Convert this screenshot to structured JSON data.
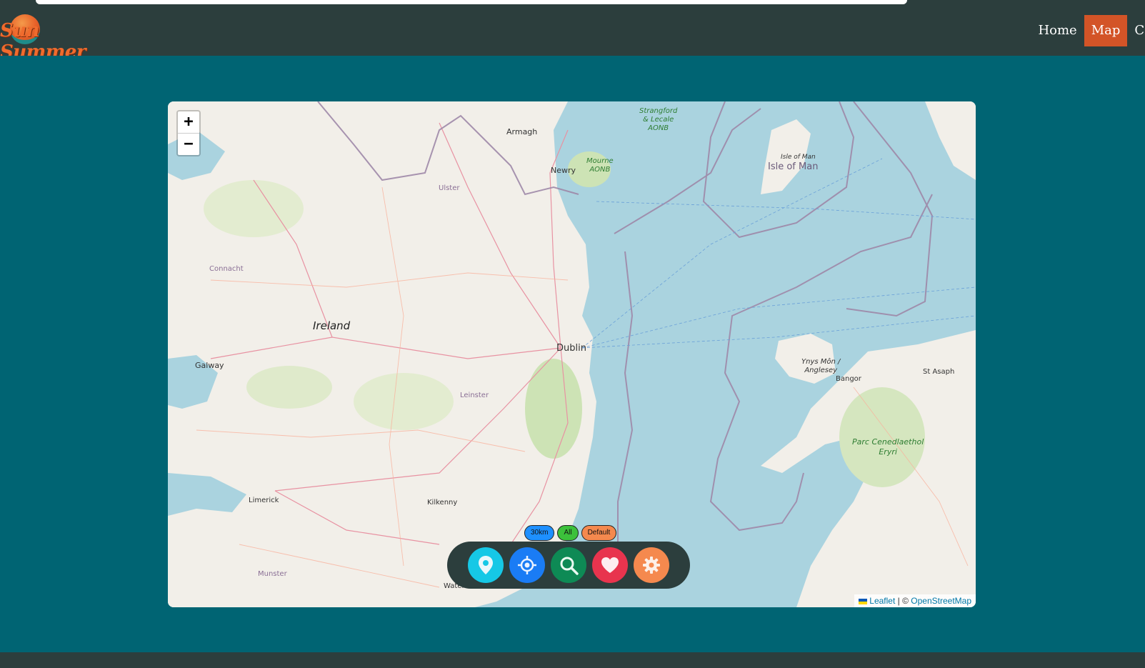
{
  "brand": {
    "logo_text": "Sun Summer"
  },
  "nav": {
    "items": [
      {
        "label": "Home",
        "active": false
      },
      {
        "label": "Map",
        "active": true
      },
      {
        "label": "Co",
        "active": false
      }
    ]
  },
  "map": {
    "zoom_in": "+",
    "zoom_out": "−",
    "labels": {
      "armagh": "Armagh",
      "newry": "Newry",
      "ulster": "Ulster",
      "strangford": "Strangford\n& Lecale\nAONB",
      "mourne": "Mourne\nAONB",
      "isle_of_man_small": "Isle of Man",
      "isle_of_man": "Isle of Man",
      "connacht": "Connacht",
      "ireland": "Ireland",
      "dublin": "Dublin",
      "galway": "Galway",
      "leinster": "Leinster",
      "ynys_mon": "Ynys Môn /\nAnglesey",
      "bangor": "Bangor",
      "st_asaph": "St Asaph",
      "eryri": "Parc Cenedlaethol\nEryri",
      "limerick": "Limerick",
      "kilkenny": "Kilkenny",
      "munster": "Munster",
      "waterford": "Water"
    },
    "attribution": {
      "leaflet": "Leaflet",
      "separator": "| ©",
      "osm": "OpenStreetMap"
    }
  },
  "filters": {
    "radius": "30km",
    "category": "All",
    "style": "Default",
    "colors": {
      "radius": "#1e90ff",
      "category": "#3cc13b",
      "style": "#f5894e"
    }
  },
  "toolbar": {
    "buttons": [
      {
        "icon": "map-pin-icon",
        "color": "#16c8e6"
      },
      {
        "icon": "crosshair-icon",
        "color": "#1a7cf5"
      },
      {
        "icon": "search-icon",
        "color": "#0e8a55"
      },
      {
        "icon": "heart-icon",
        "color": "#e8344e"
      },
      {
        "icon": "gear-icon",
        "color": "#f5894e"
      }
    ]
  },
  "colors": {
    "page_bg": "#006473",
    "navbar_bg": "#2c3e3d",
    "nav_active": "#d35427",
    "sea": "#aad3df",
    "land": "#f2efe9"
  }
}
